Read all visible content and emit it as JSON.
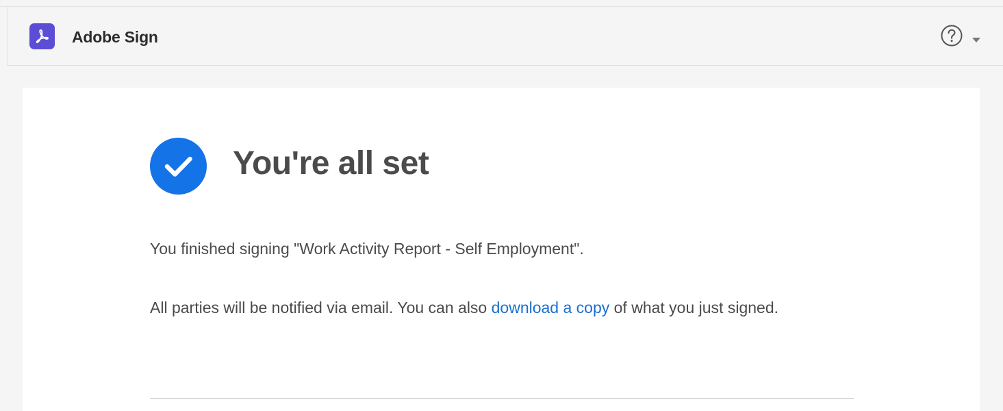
{
  "header": {
    "app_title": "Adobe Sign",
    "logo_icon": "adobe-acrobat-icon",
    "help_icon": "question-circle-icon",
    "menu_icon": "chevron-down-icon"
  },
  "confirmation": {
    "status_icon": "checkmark-circle-icon",
    "heading": "You're all set",
    "finished_message": "You finished signing \"Work Activity Report - Self Employment\".",
    "notify_prefix": "All parties will be notified via email. You can also ",
    "download_link": "download a copy",
    "notify_suffix": " of what you just signed."
  },
  "colors": {
    "brand_purple": "#5c4dd6",
    "success_blue": "#1473e6",
    "link_blue": "#1a6fd0"
  }
}
